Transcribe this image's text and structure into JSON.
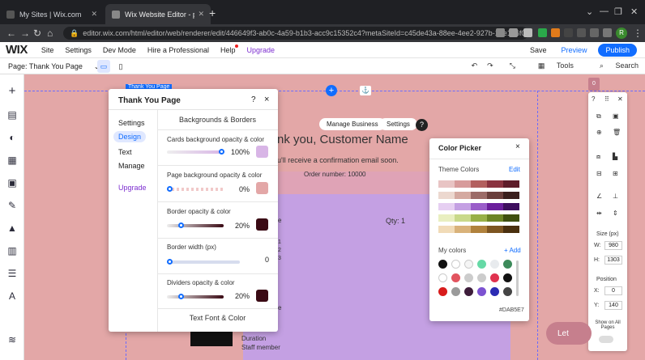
{
  "browser": {
    "tabs": [
      {
        "label": "My Sites | Wix.com",
        "active": false
      },
      {
        "label": "Wix Website Editor - portfoliosite",
        "active": true
      }
    ],
    "new_tab_symbol": "+",
    "url": "editor.wix.com/html/editor/web/renderer/edit/446649f3-ab0c-4a59-b1b3-acc9c15352c4?metaSiteId=c45de43a-88ee-4ee2-927b-14e106f0a5aa&editorSession...",
    "profile_initial": "R"
  },
  "wix_bar": {
    "logo": "WIX",
    "menu": [
      "Site",
      "Settings",
      "Dev Mode",
      "Hire a Professional",
      "Help"
    ],
    "upgrade": "Upgrade",
    "save": "Save",
    "preview": "Preview",
    "publish": "Publish"
  },
  "page_bar": {
    "page_label": "Page: Thank You Page",
    "tools": "Tools",
    "search": "Search"
  },
  "canvas": {
    "element_tag": "Thank You Page",
    "manage_business": "Manage Business",
    "settings": "Settings",
    "help": "?",
    "heading": "nk you, Customer Name",
    "confirm": "u'll receive a confirmation email soon.",
    "order": "Order number: 10000",
    "qty": "Qty: 1",
    "item_frag": "e",
    "lines": [
      "1",
      "2",
      "3"
    ],
    "duration": "Duration",
    "staff": "Staff member"
  },
  "panel": {
    "title": "Thank You Page",
    "help": "?",
    "close": "×",
    "side_menu": [
      "Settings",
      "Design",
      "Text",
      "Manage",
      "Upgrade"
    ],
    "selected_menu": "Design",
    "section_title": "Backgrounds & Borders",
    "rows": [
      {
        "label": "Cards background opacity & color",
        "value": "100",
        "unit": "%",
        "level": 1.0,
        "color": "#D8B5E6"
      },
      {
        "label": "Page background opacity & color",
        "value": "0",
        "unit": "%",
        "level": 0.0,
        "color": "#E3A7A7"
      },
      {
        "label": "Border opacity & color",
        "value": "20",
        "unit": "%",
        "level": 0.2,
        "color": "#3A0A14"
      },
      {
        "label": "Border width (px)",
        "value": "0",
        "unit": "",
        "level": 0.0,
        "color": null
      },
      {
        "label": "Dividers opacity & color",
        "value": "20",
        "unit": "%",
        "level": 0.2,
        "color": "#3A0A14"
      }
    ],
    "next_section": "Text Font & Color"
  },
  "picker": {
    "title": "Color Picker",
    "close": "×",
    "theme_colors": "Theme Colors",
    "edit": "Edit",
    "my_colors": "My colors",
    "add": "+ Add",
    "hex": "#DAB5E7",
    "theme_rows": [
      [
        "#e8c4c4",
        "#d79b9b",
        "#b3605f",
        "#8a3340",
        "#5e1c2a"
      ],
      [
        "#ecd8cf",
        "#d4a9a0",
        "#9c6c68",
        "#6a3f3c",
        "#3a1f1d"
      ],
      [
        "#e6cff2",
        "#c4a0e3",
        "#9a5dc9",
        "#6b1f9c",
        "#3e0f5e"
      ],
      [
        "#e9efc0",
        "#c9d98a",
        "#98b047",
        "#6c8425",
        "#3f4f10"
      ],
      [
        "#f1dbb7",
        "#d9b27a",
        "#b0823d",
        "#7d5521",
        "#4a300f"
      ]
    ],
    "my_color_rows": [
      [
        "#111111",
        "#ffffff",
        "#f5f5f5",
        "#66d9a6",
        "#e8ebee",
        "#3c8a5a"
      ],
      [
        "#ffffff",
        "#e2545f",
        "#cccccc",
        "#cccccc",
        "#e0324f",
        "#111111"
      ],
      [
        "#d81b1b",
        "#9a9a9a",
        "#3d1d3a",
        "#7c52d1",
        "#2b2bb3",
        "#444444"
      ]
    ]
  },
  "right_panel": {
    "size": "Size (px)",
    "w_label": "W:",
    "w_value": "980",
    "h_label": "H:",
    "h_value": "1303",
    "position": "Position",
    "x_label": "X:",
    "x_value": "0",
    "y_label": "Y:",
    "y_value": "140",
    "show_all": "Show on All Pages"
  },
  "chat": {
    "label": "Let"
  }
}
